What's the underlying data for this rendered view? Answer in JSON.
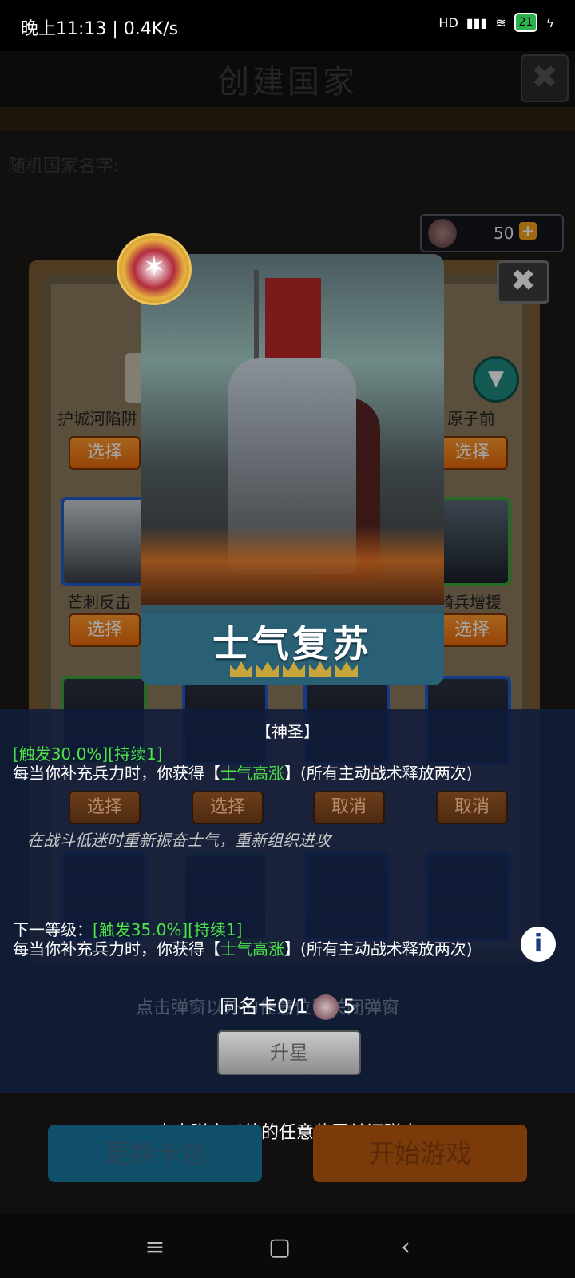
{
  "status_bar": {
    "time": "晚上11:13 | 0.4K/s",
    "network": "HD",
    "battery": "21"
  },
  "background": {
    "title": "创建国家",
    "close_label": "✖",
    "random_country_label": "随机国家名字:",
    "currency_value": "50",
    "currency_plus": "+"
  },
  "cards_row1": [
    "护城河陷阱",
    "原子前"
  ],
  "cards_row2": [
    "芒刺反击",
    "骑兵增援"
  ],
  "select_label": "选择",
  "cancel_label": "取消",
  "hero_card": {
    "name": "士气复苏",
    "stars": 5
  },
  "detail": {
    "tag": "【神圣】",
    "trigger": "[触发30.0%]",
    "duration": "[持续1]",
    "effect_prefix": "每当你补充兵力时，你获得【",
    "buff_name": "士气高涨",
    "effect_suffix": "】(所有主动战术释放两次)",
    "flavor": "在战斗低迷时重新振奋士气，重新组织进攻",
    "next_level_label": "下一等级：",
    "next_trigger": "[触发35.0%]",
    "next_duration": "[持续1]",
    "next_effect_prefix": "每当你补充兵力时，你获得【",
    "next_buff_name": "士气高涨",
    "next_effect_suffix": "】(所有主动战术释放两次)",
    "same_card_label": "同名卡0/1",
    "same_card_cost": "5",
    "upgrade_label": "升星",
    "ghost_hint": "点击弹窗以外的任意位置关闭弹窗"
  },
  "close_hint": "点击弹窗以外的任意位置关闭弹窗",
  "bottom": {
    "change_pack": "更换卡包",
    "start_game": "开始游戏"
  },
  "nav": {
    "menu_icon": "≡",
    "home_icon": "▢",
    "back_icon": "‹"
  }
}
